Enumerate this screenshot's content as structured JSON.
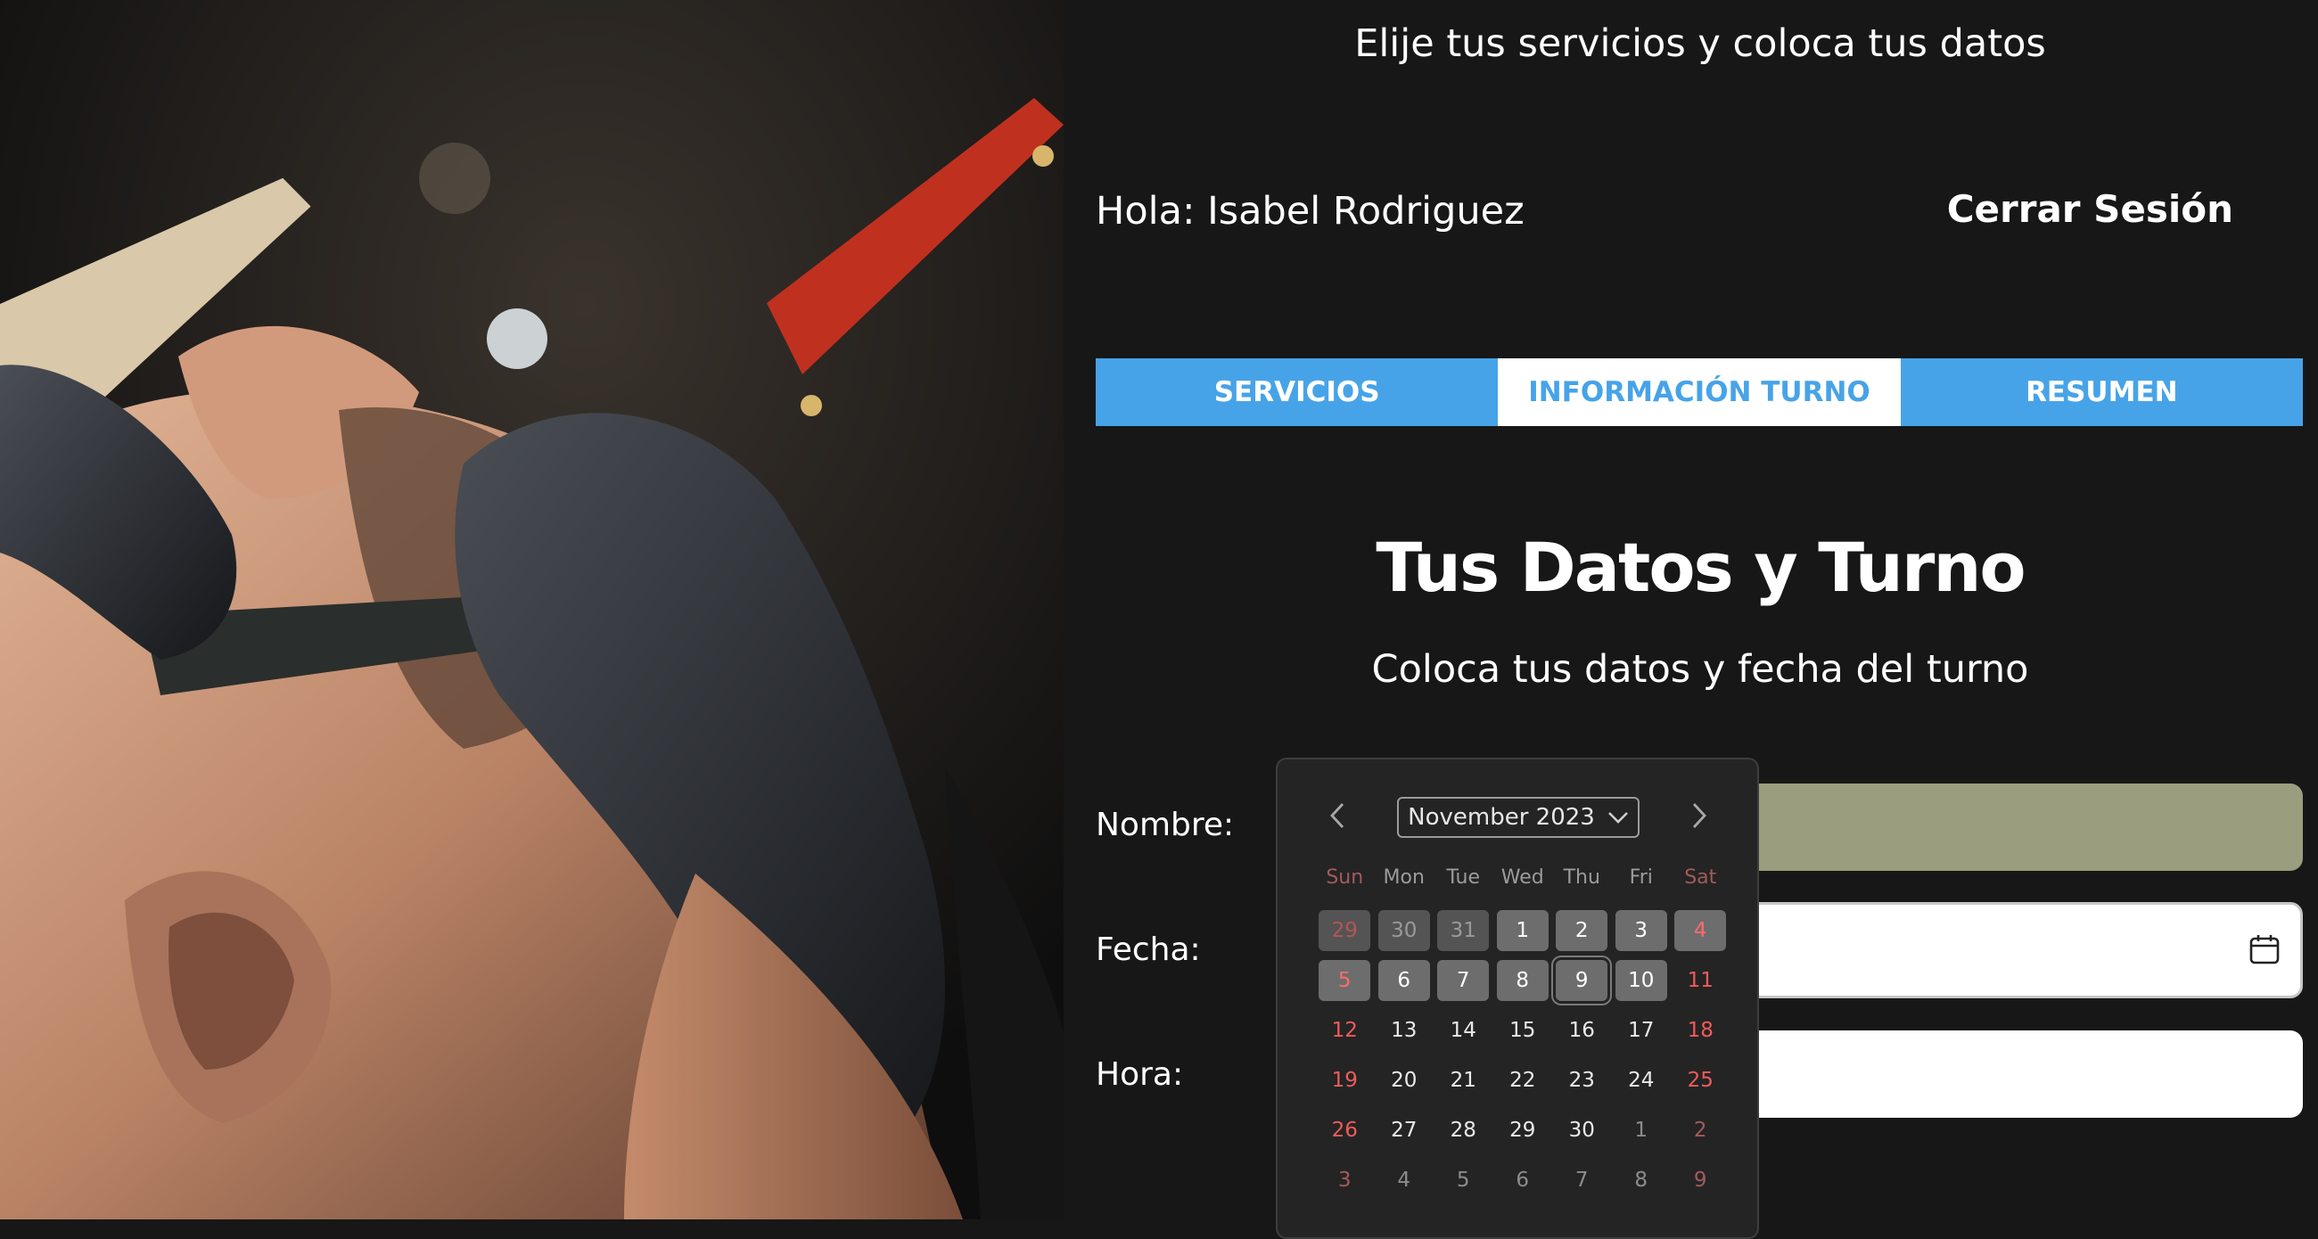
{
  "header": {
    "subtitle": "Elije tus servicios y coloca tus datos"
  },
  "user": {
    "greeting": "Hola: Isabel Rodriguez",
    "logout_label": "Cerrar Sesión"
  },
  "tabs": [
    {
      "label": "SERVICIOS",
      "active": false
    },
    {
      "label": "INFORMACIÓN TURNO",
      "active": true
    },
    {
      "label": "RESUMEN",
      "active": false
    }
  ],
  "section": {
    "title": "Tus Datos y Turno",
    "description": "Coloca tus datos y fecha del turno"
  },
  "form": {
    "name_label": "Nombre:",
    "date_label": "Fecha:",
    "time_label": "Hora:",
    "name_value": "",
    "date_value": "",
    "time_value": ""
  },
  "datepicker": {
    "month_label": "November 2023",
    "weekdays": [
      "Sun",
      "Mon",
      "Tue",
      "Wed",
      "Thu",
      "Fri",
      "Sat"
    ],
    "weeks": [
      [
        "29",
        "30",
        "31",
        "1",
        "2",
        "3",
        "4"
      ],
      [
        "5",
        "6",
        "7",
        "8",
        "9",
        "10",
        "11"
      ],
      [
        "12",
        "13",
        "14",
        "15",
        "16",
        "17",
        "18"
      ],
      [
        "19",
        "20",
        "21",
        "22",
        "23",
        "24",
        "25"
      ],
      [
        "26",
        "27",
        "28",
        "29",
        "30",
        "1",
        "2"
      ],
      [
        "3",
        "4",
        "5",
        "6",
        "7",
        "8",
        "9"
      ]
    ],
    "today": "9",
    "icons": {
      "prev": "chevron-left-icon",
      "next": "chevron-right-icon",
      "dropdown": "chevron-down-icon",
      "calendar": "calendar-icon"
    }
  },
  "colors": {
    "accent": "#47a3e8",
    "background": "#171717",
    "name_field": "#9a9d7e"
  }
}
